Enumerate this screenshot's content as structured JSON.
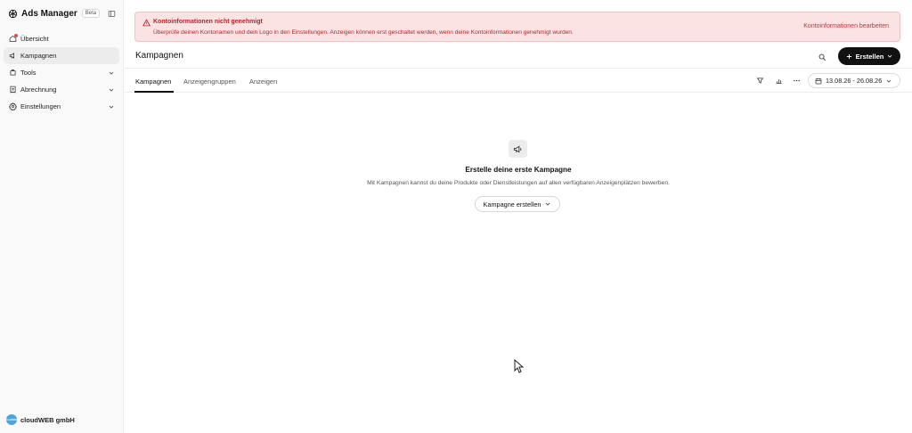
{
  "sidebar": {
    "app_name": "Ads Manager",
    "badge": "Beta",
    "items": [
      {
        "label": "Übersicht",
        "icon": "home-icon",
        "active": false
      },
      {
        "label": "Kampagnen",
        "icon": "megaphone-icon",
        "active": true
      },
      {
        "label": "Tools",
        "icon": "tools-icon",
        "expandable": true
      },
      {
        "label": "Abrechnung",
        "icon": "billing-icon",
        "expandable": true
      },
      {
        "label": "Einstellungen",
        "icon": "gear-icon",
        "expandable": true
      }
    ],
    "account_name": "cloudWEB gmbH",
    "account_avatar_text": "cloudWEB"
  },
  "alert": {
    "title": "Kontoinformationen nicht genehmigt",
    "text": "Überprüfe deinen Kontonamen und dein Logo in den Einstellungen. Anzeigen können erst geschaltet werden, wenn deine Kontoinformationen genehmigt wurden.",
    "action": "Kontoinformationen bearbeiten"
  },
  "header": {
    "title": "Kampagnen",
    "create_label": "Erstellen"
  },
  "tabs": [
    {
      "label": "Kampagnen",
      "active": true
    },
    {
      "label": "Anzeigengruppen",
      "active": false
    },
    {
      "label": "Anzeigen",
      "active": false
    }
  ],
  "date_range": "13.08.26 - 26.08.26",
  "empty_state": {
    "title": "Erstelle deine erste Kampagne",
    "text": "Mit Kampagnen kannst du deine Produkte oder Dienstleistungen auf allen verfügbaren Anzeigenplätzen bewerben.",
    "button": "Kampagne erstellen"
  },
  "colors": {
    "alert_bg": "#fbe3e3",
    "alert_text": "#b4232b",
    "primary_button": "#111111",
    "notification_dot": "#e0484f"
  }
}
